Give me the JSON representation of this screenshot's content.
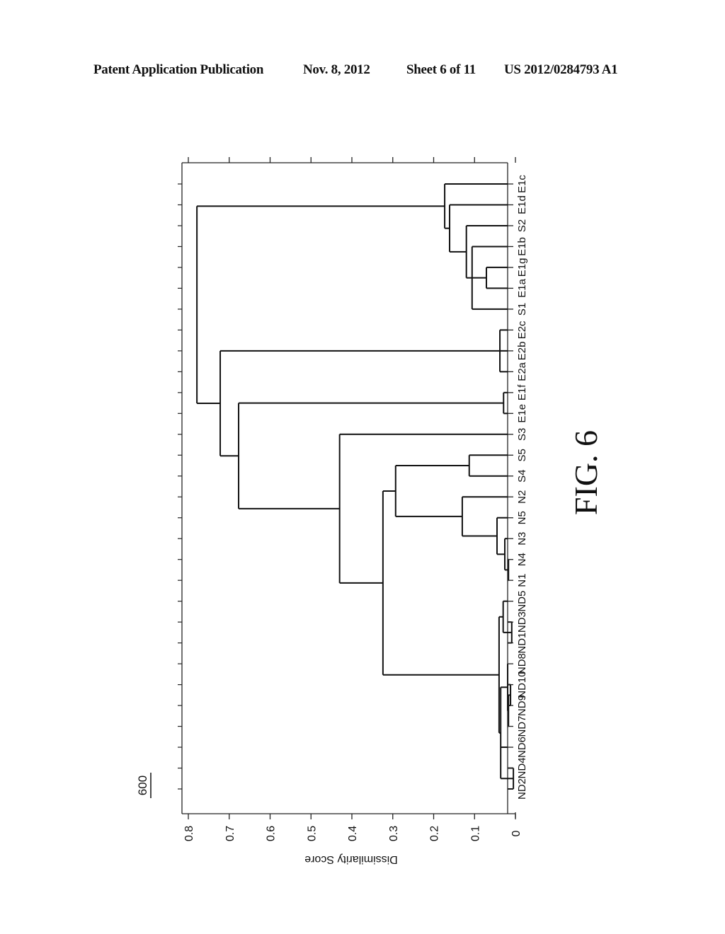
{
  "header": {
    "publication": "Patent Application Publication",
    "date": "Nov. 8, 2012",
    "sheet": "Sheet 6 of 11",
    "number": "US 2012/0284793 A1"
  },
  "figure": {
    "reference": "600",
    "caption": "FIG. 6"
  },
  "chart_data": {
    "type": "dendrogram",
    "title": "",
    "orientation": "rotated 90° (leaves along right edge, dissimilarity increasing to the left)",
    "ylabel": "Dissimilarity Score",
    "xlabel": "",
    "ylim": [
      0,
      0.8
    ],
    "ticks": [
      "0.8",
      "0.7",
      "0.6",
      "0.5",
      "0.4",
      "0.3",
      "0.2",
      "0.1",
      "0"
    ],
    "tick_values": [
      0.8,
      0.7,
      0.6,
      0.5,
      0.4,
      0.3,
      0.2,
      0.1,
      0
    ],
    "leaves": [
      "E1c",
      "E1d",
      "S2",
      "E1b",
      "E1g",
      "E1a",
      "S1",
      "E2c",
      "E2b",
      "E2a",
      "E1f",
      "E1e",
      "S3",
      "S5",
      "S4",
      "N2",
      "N5",
      "N3",
      "N4",
      "N1",
      "ND5",
      "ND3",
      "ND1",
      "ND8",
      "ND10",
      "ND9",
      "ND7",
      "ND6",
      "ND4",
      "ND2"
    ],
    "merges": [
      {
        "id": "m1",
        "children": [
          "E1g",
          "E1a"
        ],
        "height": 0.071
      },
      {
        "id": "m2",
        "children": [
          "E1b",
          "m1",
          "S1"
        ],
        "height": 0.106
      },
      {
        "id": "m3",
        "children": [
          "S2",
          "m2"
        ],
        "height": 0.12
      },
      {
        "id": "m4",
        "children": [
          "E1d",
          "m3"
        ],
        "height": 0.161
      },
      {
        "id": "m5",
        "children": [
          "E1c",
          "m4"
        ],
        "height": 0.173
      },
      {
        "id": "m6",
        "children": [
          "E2c",
          "E2b",
          "E2a"
        ],
        "height": 0.038
      },
      {
        "id": "m7",
        "children": [
          "E1f",
          "E1e"
        ],
        "height": 0.029
      },
      {
        "id": "m8",
        "children": [
          "S5",
          "S4"
        ],
        "height": 0.113
      },
      {
        "id": "m9",
        "children": [
          "N4",
          "N1"
        ],
        "height": 0.017
      },
      {
        "id": "m10",
        "children": [
          "N3",
          "m9"
        ],
        "height": 0.026
      },
      {
        "id": "m11",
        "children": [
          "N5",
          "m10"
        ],
        "height": 0.045
      },
      {
        "id": "m12",
        "children": [
          "N2",
          "m11"
        ],
        "height": 0.13
      },
      {
        "id": "m13",
        "children": [
          "m8",
          "m12"
        ],
        "height": 0.293
      },
      {
        "id": "m14",
        "children": [
          "ND3",
          "ND1"
        ],
        "height": 0.009
      },
      {
        "id": "m15",
        "children": [
          "ND5",
          "m14"
        ],
        "height": 0.03
      },
      {
        "id": "m16",
        "children": [
          "ND10",
          "ND9"
        ],
        "height": 0.012
      },
      {
        "id": "m17",
        "children": [
          "m16",
          "ND7"
        ],
        "height": 0.017
      },
      {
        "id": "m18",
        "children": [
          "ND8",
          "m17"
        ],
        "height": 0.019
      },
      {
        "id": "m19",
        "children": [
          "ND4",
          "ND2"
        ],
        "height": 0.005
      },
      {
        "id": "m20",
        "children": [
          "m18",
          "ND6",
          "m19"
        ],
        "height": 0.036
      },
      {
        "id": "m21",
        "children": [
          "m15",
          "m20"
        ],
        "height": 0.04
      },
      {
        "id": "m22",
        "children": [
          "m13",
          "m21"
        ],
        "height": 0.324
      },
      {
        "id": "m23",
        "children": [
          "S3",
          "m22"
        ],
        "height": 0.43
      },
      {
        "id": "m24",
        "children": [
          "m7",
          "m23"
        ],
        "height": 0.677
      },
      {
        "id": "m25",
        "children": [
          "m6",
          "m24"
        ],
        "height": 0.722
      },
      {
        "id": "m26",
        "children": [
          "m5",
          "m25"
        ],
        "height": 0.779
      }
    ],
    "grid": false,
    "legend": "none"
  }
}
